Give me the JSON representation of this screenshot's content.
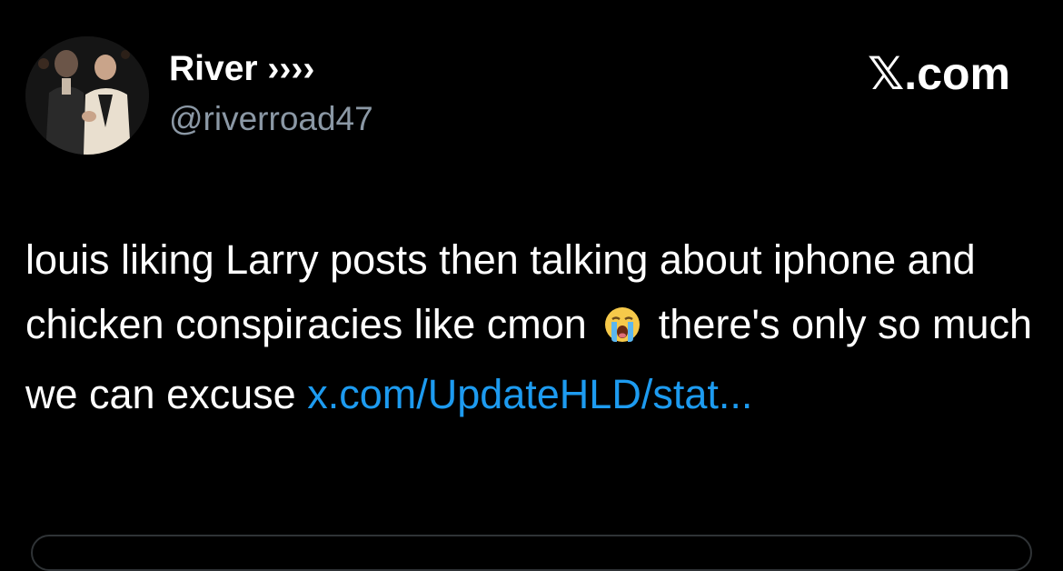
{
  "post": {
    "author": {
      "display_name": "River ››››",
      "handle": "@riverroad47"
    },
    "brand": "𝕏.com",
    "text_before_emoji": "louis liking Larry posts then talking about iphone and chicken conspiracies like cmon",
    "emoji": "loudly-crying-face-emoji",
    "text_after_emoji": "there's only so much we can excuse",
    "link": "x.com/UpdateHLD/stat..."
  },
  "colors": {
    "background": "#000000",
    "text": "#ffffff",
    "secondary_text": "#8b98a5",
    "link": "#1d9bf0"
  }
}
